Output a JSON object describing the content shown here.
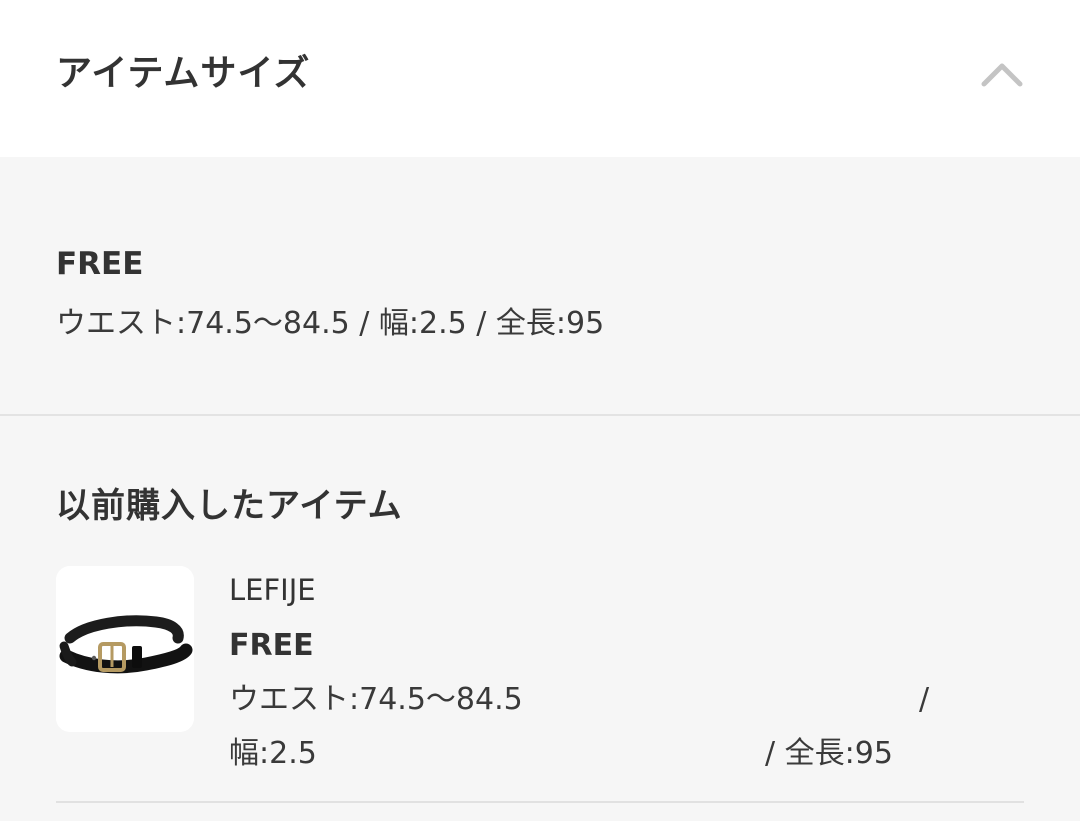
{
  "header": {
    "title": "アイテムサイズ",
    "collapse_icon": "chevron-up-icon"
  },
  "size": {
    "name": "FREE",
    "detail": "ウエスト:74.5～84.5 / 幅:2.5 / 全長:95"
  },
  "previous": {
    "title": "以前購入したアイテム",
    "items": [
      {
        "thumbnail_icon": "belt-image",
        "brand": "LEFIJE",
        "size": "FREE",
        "line1": "ウエスト:74.5～84.5",
        "separator": "/",
        "line2_start": "幅:2.5",
        "line2_end": "/ 全長:95"
      }
    ]
  },
  "colors": {
    "header_bg": "#ffffff",
    "page_bg": "#f6f6f6",
    "text": "#333333",
    "chevron": "#c4c4c4",
    "divider": "#e3e3e3"
  }
}
